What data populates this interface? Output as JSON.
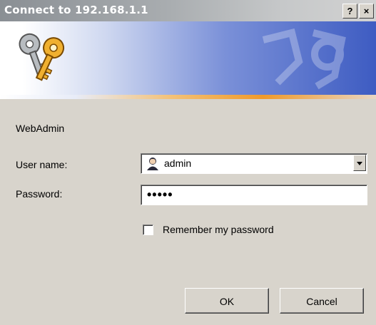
{
  "window": {
    "title": "Connect to 192.168.1.1",
    "help_button": "?",
    "close_button": "×"
  },
  "realm": "WebAdmin",
  "form": {
    "username_label": "User name:",
    "username_value": "admin",
    "password_label": "Password:",
    "password_value": "•••••",
    "remember_label": "Remember my password",
    "remember_checked": false
  },
  "buttons": {
    "ok": "OK",
    "cancel": "Cancel"
  },
  "icons": [
    "keys-icon",
    "user-icon",
    "dropdown-arrow-icon",
    "help-icon",
    "close-icon"
  ]
}
